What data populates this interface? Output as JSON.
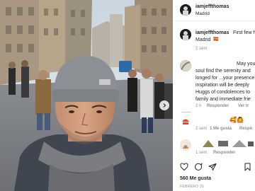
{
  "post": {
    "username": "iamjeffthomas",
    "location": "Madrid"
  },
  "caption": {
    "username": "iamjeffthomas",
    "text_line1": "First few h",
    "text_line2": "Madrid",
    "emoji": "🇪🇸",
    "time": "2 sem"
  },
  "comment1": {
    "line1": "May you",
    "line2": "soul find the serenity and",
    "line3": "longed for ...your presence",
    "line4": "inspiration will be deeply",
    "line5": "Huggs of condolences to",
    "line6": "family and immediate frie",
    "time": "2 h",
    "reply_label": "Responder",
    "translate_label": "Ver tr"
  },
  "comment2": {
    "emojis": "🥰🙆",
    "time": "2 sem",
    "likes": "1 Me gusta",
    "reply_label": "Respo"
  },
  "comment3": {
    "time": "1 sem",
    "reply_label": "Responder"
  },
  "actions": {
    "likes": "560 Me gusta",
    "date": "FEBRERO 26"
  },
  "colors": {
    "accent": "#0095f6",
    "text": "#262626",
    "muted": "#8e8e8e",
    "heart_red": "#ed4956"
  }
}
